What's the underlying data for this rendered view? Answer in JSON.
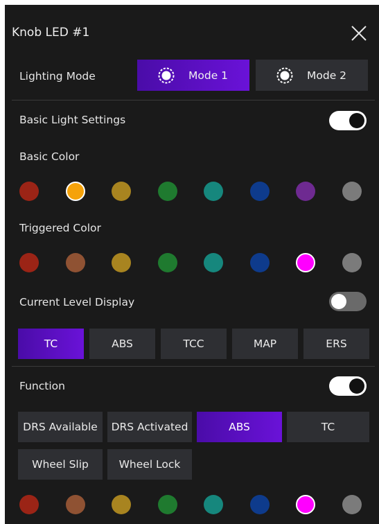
{
  "panel": {
    "title": "Knob LED #1"
  },
  "lighting_mode": {
    "label": "Lighting Mode",
    "options": [
      "Mode 1",
      "Mode 2"
    ],
    "selected": "Mode 1"
  },
  "basic_light": {
    "label": "Basic Light Settings",
    "toggle_on": true,
    "basic_color_label": "Basic Color",
    "basic_colors": [
      "#9b2416",
      "#f5a20a",
      "#a88420",
      "#1f7a2f",
      "#16877d",
      "#0e3b8c",
      "#6e2a91",
      "#7b7b7b"
    ],
    "basic_selected_index": 1,
    "triggered_color_label": "Triggered Color",
    "triggered_colors": [
      "#9b2416",
      "#8f5233",
      "#a88420",
      "#1f7a2f",
      "#16877d",
      "#0e3b8c",
      "#ff00ff",
      "#7b7b7b"
    ],
    "triggered_selected_index": 6
  },
  "level_display": {
    "label": "Current Level Display",
    "toggle_on": false,
    "options": [
      "TC",
      "ABS",
      "TCC",
      "MAP",
      "ERS"
    ],
    "selected": "TC"
  },
  "function": {
    "label": "Function",
    "toggle_on": true,
    "row1": [
      "DRS Available",
      "DRS Activated",
      "ABS",
      "TC"
    ],
    "row2": [
      "Wheel Slip",
      "Wheel Lock"
    ],
    "selected": "ABS",
    "colors": [
      "#9b2416",
      "#8f5233",
      "#a88420",
      "#1f7a2f",
      "#16877d",
      "#0e3b8c",
      "#ff00ff",
      "#7b7b7b"
    ],
    "selected_color_index": 6
  },
  "icons": {
    "close": "close-icon",
    "mode": "dashed-ring-icon"
  }
}
